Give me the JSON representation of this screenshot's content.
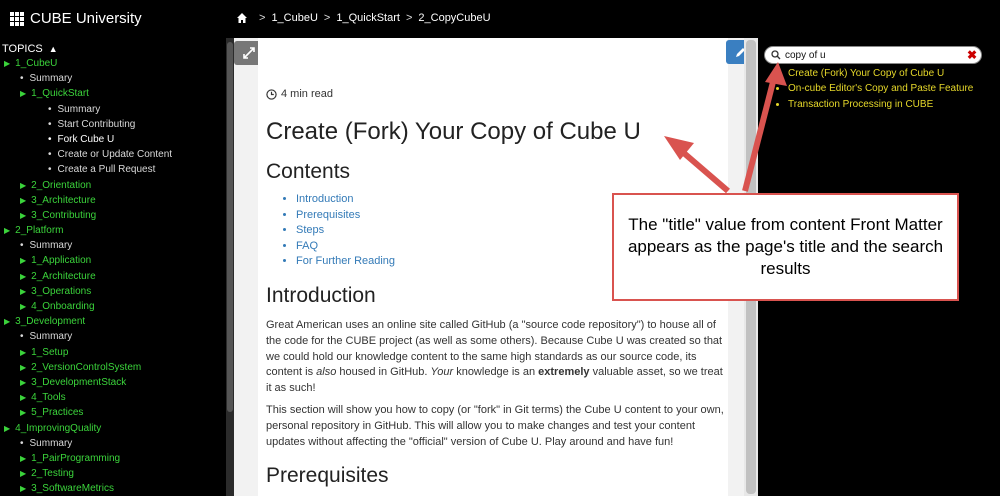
{
  "app": {
    "title": "CUBE University"
  },
  "breadcrumb": [
    "1_CubeU",
    "1_QuickStart",
    "2_CopyCubeU"
  ],
  "sidebar": {
    "header": "TOPICS",
    "items": [
      {
        "label": "1_CubeU",
        "level": 0,
        "style": "g"
      },
      {
        "label": "Summary",
        "level": 1,
        "style": "s"
      },
      {
        "label": "1_QuickStart",
        "level": 1,
        "style": "g"
      },
      {
        "label": "Summary",
        "level": 2,
        "style": "s"
      },
      {
        "label": "Start Contributing",
        "level": 2,
        "style": "s"
      },
      {
        "label": "Fork Cube U",
        "level": 2,
        "style": "w"
      },
      {
        "label": "Create or Update Content",
        "level": 2,
        "style": "s"
      },
      {
        "label": "Create a Pull Request",
        "level": 2,
        "style": "s"
      },
      {
        "label": "2_Orientation",
        "level": 1,
        "style": "g"
      },
      {
        "label": "3_Architecture",
        "level": 1,
        "style": "g"
      },
      {
        "label": "3_Contributing",
        "level": 1,
        "style": "g"
      },
      {
        "label": "2_Platform",
        "level": 0,
        "style": "g"
      },
      {
        "label": "Summary",
        "level": 1,
        "style": "s"
      },
      {
        "label": "1_Application",
        "level": 1,
        "style": "g"
      },
      {
        "label": "2_Architecture",
        "level": 1,
        "style": "g"
      },
      {
        "label": "3_Operations",
        "level": 1,
        "style": "g"
      },
      {
        "label": "4_Onboarding",
        "level": 1,
        "style": "g"
      },
      {
        "label": "3_Development",
        "level": 0,
        "style": "g"
      },
      {
        "label": "Summary",
        "level": 1,
        "style": "s"
      },
      {
        "label": "1_Setup",
        "level": 1,
        "style": "g"
      },
      {
        "label": "2_VersionControlSystem",
        "level": 1,
        "style": "g"
      },
      {
        "label": "3_DevelopmentStack",
        "level": 1,
        "style": "g"
      },
      {
        "label": "4_Tools",
        "level": 1,
        "style": "g"
      },
      {
        "label": "5_Practices",
        "level": 1,
        "style": "g"
      },
      {
        "label": "4_ImprovingQuality",
        "level": 0,
        "style": "g"
      },
      {
        "label": "Summary",
        "level": 1,
        "style": "s"
      },
      {
        "label": "1_PairProgramming",
        "level": 1,
        "style": "g"
      },
      {
        "label": "2_Testing",
        "level": 1,
        "style": "g"
      },
      {
        "label": "3_SoftwareMetrics",
        "level": 1,
        "style": "g"
      }
    ]
  },
  "article": {
    "read_time": "4 min read",
    "title": "Create (Fork) Your Copy of Cube U",
    "contents_heading": "Contents",
    "toc": [
      "Introduction",
      "Prerequisites",
      "Steps",
      "FAQ",
      "For Further Reading"
    ],
    "intro_heading": "Introduction",
    "intro_p1_a": "Great American uses an online site called GitHub (a \"source code repository\") to house all of the code for the CUBE project (as well as some others). Because Cube U was created so that we could hold our knowledge content to the same high standards as our source code, its content is ",
    "intro_p1_also": "also",
    "intro_p1_b": " housed in GitHub. ",
    "intro_p1_your": "Your",
    "intro_p1_c": " knowledge is an ",
    "intro_p1_extremely": "extremely",
    "intro_p1_d": " valuable asset, so we treat it as such!",
    "intro_p2": "This section will show you how to copy (or \"fork\" in Git terms) the Cube U content to your own, personal repository in GitHub. This will allow you to make changes and test your content updates without affecting the \"official\" version of Cube U. Play around and have fun!",
    "prereq_heading": "Prerequisites"
  },
  "search": {
    "value": "copy of u",
    "results": [
      "Create (Fork) Your Copy of Cube U",
      "On-cube Editor's Copy and Paste Feature",
      "Transaction Processing in CUBE"
    ]
  },
  "callout": {
    "text": "The \"title\" value from content Front Matter appears as the page's title and the search results",
    "color": "#d9534f"
  }
}
